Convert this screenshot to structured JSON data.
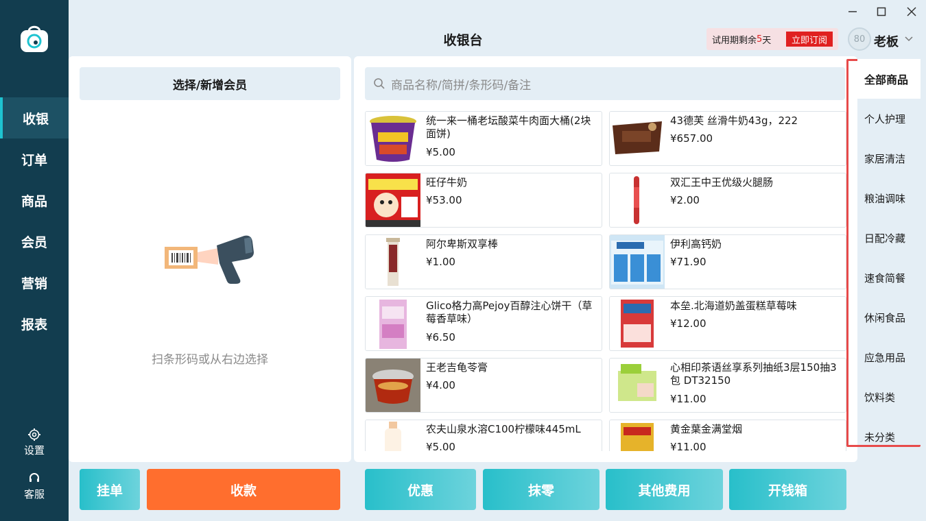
{
  "window": {
    "minimize": "—",
    "maximize": "☐",
    "close": "✕"
  },
  "header": {
    "title": "收银台",
    "trial_prefix": "试用期剩余",
    "trial_days": "5",
    "trial_suffix": "天",
    "subscribe": "立即订阅",
    "avatar_text": "80",
    "username": "老板"
  },
  "sidebar": {
    "items": [
      {
        "label": "收银"
      },
      {
        "label": "订单"
      },
      {
        "label": "商品"
      },
      {
        "label": "会员"
      },
      {
        "label": "营销"
      },
      {
        "label": "报表"
      }
    ],
    "active": "收银",
    "settings": "设置",
    "support": "客服"
  },
  "left": {
    "member_button": "选择/新增会员",
    "scan_hint": "扫条形码或从右边选择"
  },
  "search": {
    "placeholder": "商品名称/简拼/条形码/备注"
  },
  "products": [
    {
      "name": "统一来一桶老坛酸菜牛肉面大桶(2块面饼)",
      "price": "¥5.00"
    },
    {
      "name": "43德芙 丝滑牛奶43g，222",
      "price": "¥657.00"
    },
    {
      "name": "旺仔牛奶",
      "price": "¥53.00"
    },
    {
      "name": "双汇王中王优级火腿肠",
      "price": "¥2.00"
    },
    {
      "name": "阿尔卑斯双享棒",
      "price": "¥1.00"
    },
    {
      "name": "伊利高钙奶",
      "price": "¥71.90"
    },
    {
      "name": "Glico格力高Pejoy百醇注心饼干（草莓香草味）",
      "price": "¥6.50"
    },
    {
      "name": "本垒.北海道奶盖蛋糕草莓味",
      "price": "¥12.00"
    },
    {
      "name": "王老吉龟苓膏",
      "price": "¥4.00"
    },
    {
      "name": "心相印茶语丝享系列抽纸3层150抽3包 DT32150",
      "price": "¥11.00"
    },
    {
      "name": "农夫山泉水溶C100柠檬味445mL",
      "price": "¥5.00"
    },
    {
      "name": "黄金葉金满堂烟",
      "price": "¥11.00"
    }
  ],
  "categories": [
    {
      "label": "全部商品"
    },
    {
      "label": "个人护理"
    },
    {
      "label": "家居清洁"
    },
    {
      "label": "粮油调味"
    },
    {
      "label": "日配冷藏"
    },
    {
      "label": "速食简餐"
    },
    {
      "label": "休闲食品"
    },
    {
      "label": "应急用品"
    },
    {
      "label": "饮料类"
    },
    {
      "label": "未分类"
    }
  ],
  "buttons": {
    "hold": "挂单",
    "checkout": "收款",
    "discount": "优惠",
    "round_off": "抹零",
    "other_fees": "其他费用",
    "open_drawer": "开钱箱"
  },
  "colors": {
    "sidebar_bg": "#123d4f",
    "accent_teal": "#28bfca",
    "checkout_orange": "#ff6e2e",
    "highlight_red": "#e74a4a"
  }
}
